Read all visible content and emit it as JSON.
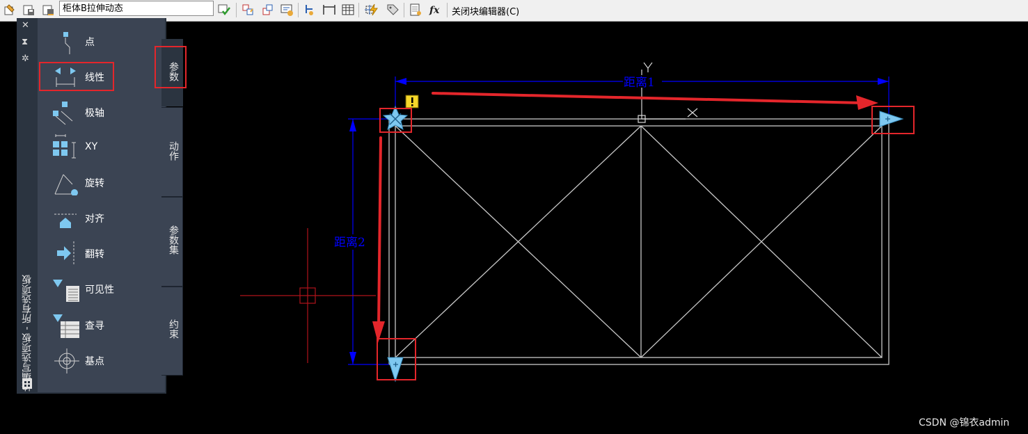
{
  "toolbar": {
    "block_name": "柜体B拉伸动态",
    "close_editor_label": "关闭块编辑器(C)",
    "icons": [
      "edit-block-icon",
      "save-block-icon",
      "save-block-as-icon",
      "test-block-icon",
      "authoring-palettes-icon",
      "parameter-manager-icon",
      "attribute-definition-icon",
      "point-icon",
      "table-icon",
      "action-icon",
      "lightning-icon",
      "tag-icon",
      "properties-icon",
      "fx-icon"
    ]
  },
  "palette": {
    "title": "块编写选项板 - 所有选项板",
    "controls": [
      "close-icon",
      "autohide-icon",
      "settings-icon"
    ],
    "items": [
      {
        "label": "点",
        "icon": "point-parameter-icon"
      },
      {
        "label": "线性",
        "icon": "linear-parameter-icon"
      },
      {
        "label": "极轴",
        "icon": "polar-parameter-icon"
      },
      {
        "label": "XY",
        "icon": "xy-parameter-icon"
      },
      {
        "label": "旋转",
        "icon": "rotation-parameter-icon"
      },
      {
        "label": "对齐",
        "icon": "alignment-parameter-icon"
      },
      {
        "label": "翻转",
        "icon": "flip-parameter-icon"
      },
      {
        "label": "可见性",
        "icon": "visibility-parameter-icon"
      },
      {
        "label": "查寻",
        "icon": "lookup-parameter-icon"
      },
      {
        "label": "基点",
        "icon": "basepoint-parameter-icon"
      }
    ],
    "tabs": [
      {
        "label": "参数",
        "active": true
      },
      {
        "label": "动作",
        "active": false
      },
      {
        "label": "参数集",
        "active": false
      },
      {
        "label": "约束",
        "active": false
      }
    ]
  },
  "drawing": {
    "distance1_label": "距离1",
    "distance2_label": "距离2",
    "ucs_y_label": "Y",
    "colors": {
      "dimension": "#0000ff",
      "annotation": "#e4262b",
      "geometry": "#c8c8c8",
      "grip": "#7ec8f0",
      "crosshair": "#b0131b"
    }
  },
  "watermark": "CSDN @锦衣admin"
}
